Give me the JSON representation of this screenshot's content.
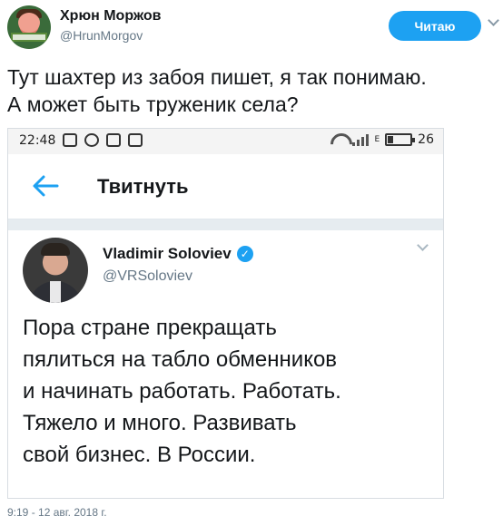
{
  "header": {
    "author_name": "Хрюн Моржов",
    "author_handle": "@HrunMorgov",
    "follow_label": "Читаю"
  },
  "tweet": {
    "text_line1": "Тут шахтер из забоя пишет, я так понимаю.",
    "text_line2": "А может быть труженик села?",
    "timestamp": "9:19 - 12 авг. 2018 г."
  },
  "screenshot": {
    "status_time": "22:48",
    "status_e": "E",
    "battery_percent": "26",
    "battery_level": 0.26,
    "appbar_title": "Твитнуть",
    "quoted": {
      "name": "Vladimir Soloviev",
      "handle": "@VRSoloviev",
      "text_lines": [
        "Пора стране прекращать",
        "пялиться на табло обменников",
        "и начинать работать. Работать.",
        "Тяжело и много. Развивать",
        "свой бизнес. В России."
      ]
    }
  },
  "colors": {
    "accent": "#1da1f2",
    "muted": "#657786"
  }
}
